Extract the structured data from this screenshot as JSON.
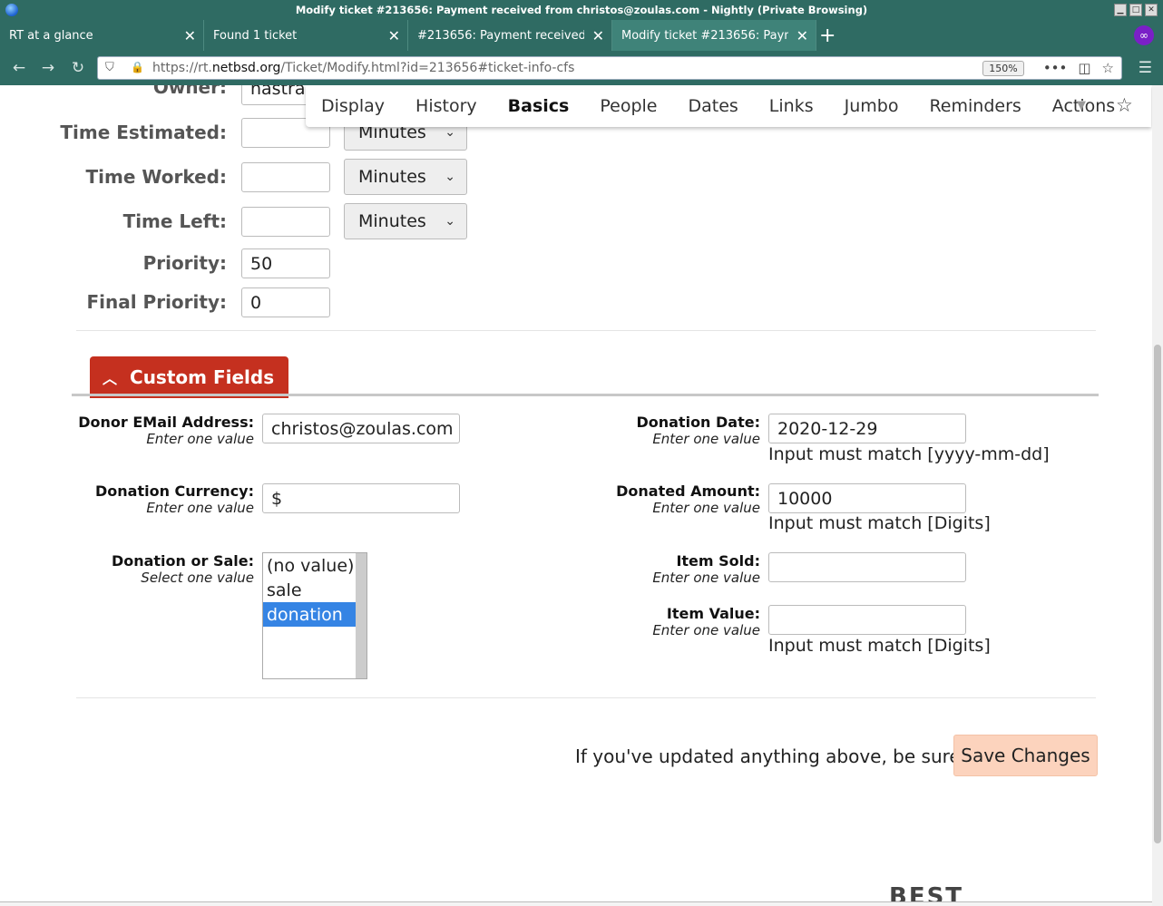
{
  "window": {
    "title": "Modify ticket #213656: Payment received from christos@zoulas.com - Nightly (Private Browsing)",
    "private_icon": "mask-icon"
  },
  "tabs": [
    {
      "label": "RT at a glance"
    },
    {
      "label": "Found 1 ticket"
    },
    {
      "label": "#213656: Payment received from christos@zoulas.com"
    },
    {
      "label": "Modify ticket #213656: Payment received from christos@zoulas.com"
    }
  ],
  "nav": {
    "url_prefix": "https://rt.",
    "url_domain": "netbsd.org",
    "url_rest": "/Ticket/Modify.html?id=213656#ticket-info-cfs",
    "zoom": "150%"
  },
  "page_menu": {
    "items": [
      "Display",
      "History",
      "Basics",
      "People",
      "Dates",
      "Links",
      "Jumbo",
      "Reminders",
      "Actions"
    ],
    "active": "Basics"
  },
  "basics": {
    "owner_label": "Owner:",
    "owner_value": "nastra",
    "time_estimated_label": "Time Estimated:",
    "time_estimated_value": "",
    "time_estimated_unit": "Minutes",
    "time_worked_label": "Time Worked:",
    "time_worked_value": "",
    "time_worked_unit": "Minutes",
    "time_left_label": "Time Left:",
    "time_left_value": "",
    "time_left_unit": "Minutes",
    "priority_label": "Priority:",
    "priority_value": "50",
    "final_priority_label": "Final Priority:",
    "final_priority_value": "0"
  },
  "custom_fields": {
    "title": "Custom Fields",
    "donor_email": {
      "name": "Donor EMail Address:",
      "hint": "Enter one value",
      "value": "christos@zoulas.com"
    },
    "donation_currency": {
      "name": "Donation Currency:",
      "hint": "Enter one value",
      "value": "$"
    },
    "donation_or_sale": {
      "name": "Donation or Sale:",
      "hint": "Select one value",
      "options": [
        "(no value)",
        "sale",
        "donation"
      ],
      "selected": "donation"
    },
    "donation_date": {
      "name": "Donation Date:",
      "hint": "Enter one value",
      "value": "2020-12-29",
      "format": "Input must match [yyyy-mm-dd]"
    },
    "donated_amount": {
      "name": "Donated Amount:",
      "hint": "Enter one value",
      "value": "10000",
      "format": "Input must match [Digits]"
    },
    "item_sold": {
      "name": "Item Sold:",
      "hint": "Enter one value",
      "value": ""
    },
    "item_value": {
      "name": "Item Value:",
      "hint": "Enter one value",
      "value": "",
      "format": "Input must match [Digits]"
    }
  },
  "save": {
    "text": "If you've updated anything above, be sure to",
    "button": "Save Changes"
  },
  "footer_logo": "BEST"
}
